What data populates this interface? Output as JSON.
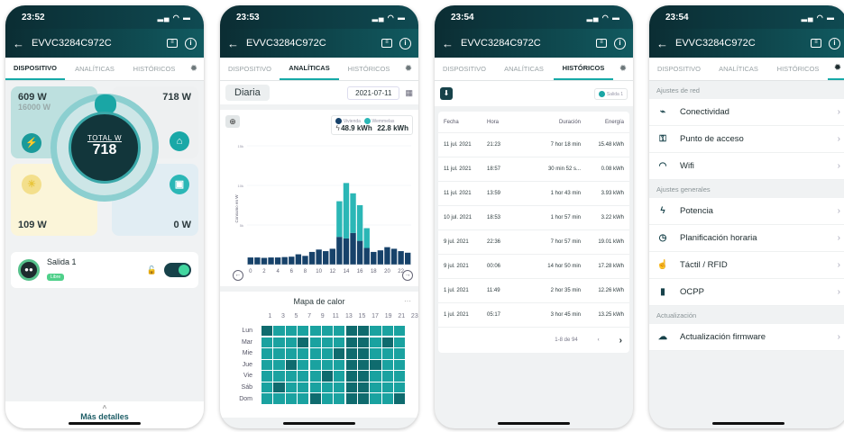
{
  "phones": [
    {
      "time": "23:52",
      "device": "EVVC3284C972C"
    },
    {
      "time": "23:53",
      "device": "EVVC3284C972C"
    },
    {
      "time": "23:54",
      "device": "EVVC3284C972C"
    },
    {
      "time": "23:54",
      "device": "EVVC3284C972C"
    }
  ],
  "tabs": {
    "device": "DISPOSITIVO",
    "analytics": "ANALÍTICAS",
    "history": "HISTÓRICOS"
  },
  "device_screen": {
    "grid_power": "609 W",
    "grid_limit": "16000 W",
    "home_power": "718 W",
    "solar_power": "109 W",
    "car_power": "0 W",
    "total_label": "TOTAL W",
    "total_value": "718",
    "outlet_name": "Salida 1",
    "outlet_status": "Libre",
    "more_details": "Más detalles"
  },
  "analytics_screen": {
    "period": "Diaria",
    "date": "2021-07-11",
    "legend_home_label": "Vivienda",
    "legend_home_value": "48.9 kWh",
    "legend_charger_label": "Wemmelas",
    "legend_charger_value": "22.8 kWh",
    "heatmap_title": "Mapa de calor",
    "heatmap_hours": [
      "1",
      "3",
      "5",
      "7",
      "9",
      "11",
      "13",
      "15",
      "17",
      "19",
      "21",
      "23"
    ],
    "heatmap_days": [
      "Lun",
      "Mar",
      "Mie",
      "Jue",
      "Vie",
      "Sáb",
      "Dom"
    ]
  },
  "chart_data": {
    "type": "bar",
    "title": "",
    "ylabel": "Consumo en W",
    "categories": [
      "0",
      "1",
      "2",
      "3",
      "4",
      "5",
      "6",
      "7",
      "8",
      "9",
      "10",
      "11",
      "12",
      "13",
      "14",
      "15",
      "16",
      "17",
      "18",
      "19",
      "20",
      "21",
      "22",
      "23"
    ],
    "x_tick_labels": [
      "0",
      "2",
      "4",
      "6",
      "8",
      "10",
      "12",
      "14",
      "16",
      "18",
      "20",
      "22"
    ],
    "y_tick_labels": [
      "15k",
      "10k",
      "5k"
    ],
    "ylim": [
      0,
      15000
    ],
    "series": [
      {
        "name": "Vivienda",
        "values": [
          900,
          900,
          850,
          900,
          900,
          950,
          1000,
          1300,
          1100,
          1600,
          1900,
          1700,
          2000,
          3500,
          3300,
          4000,
          3000,
          2100,
          1600,
          1800,
          2200,
          2000,
          1700,
          1500
        ],
        "color": "#17426a"
      },
      {
        "name": "Wemmelas",
        "values": [
          0,
          0,
          0,
          0,
          0,
          0,
          0,
          0,
          0,
          0,
          0,
          0,
          0,
          4500,
          7000,
          5000,
          4500,
          2500,
          0,
          0,
          0,
          0,
          0,
          0
        ],
        "color": "#2bb7b6"
      }
    ]
  },
  "history_screen": {
    "salida_label": "Salida 1",
    "headers": [
      "Fecha",
      "Hora",
      "Duración",
      "Energía"
    ],
    "rows": [
      [
        "11 jul. 2021",
        "21:23",
        "7 hor 18 min",
        "15.48 kWh"
      ],
      [
        "11 jul. 2021",
        "18:57",
        "30 min 52 s...",
        "0.08 kWh"
      ],
      [
        "11 jul. 2021",
        "13:59",
        "1 hor 43 min",
        "3.93 kWh"
      ],
      [
        "10 jul. 2021",
        "18:53",
        "1 hor 57 min",
        "3.22 kWh"
      ],
      [
        "9 jul. 2021",
        "22:36",
        "7 hor 57 min",
        "19.01 kWh"
      ],
      [
        "9 jul. 2021",
        "00:06",
        "14 hor 50 min",
        "17.28 kWh"
      ],
      [
        "1 jul. 2021",
        "11:49",
        "2 hor 35 min",
        "12.26 kWh"
      ],
      [
        "1 jul. 2021",
        "05:17",
        "3 hor 45 min",
        "13.25 kWh"
      ]
    ],
    "pager": "1-8 de 94"
  },
  "settings_screen": {
    "section_network": "Ajustes de red",
    "network_items": [
      "Conectividad",
      "Punto de acceso",
      "Wifi"
    ],
    "section_general": "Ajustes generales",
    "general_items": [
      "Potencia",
      "Planificación horaria",
      "Táctil / RFID",
      "OCPP"
    ],
    "section_update": "Actualización",
    "update_items": [
      "Actualización firmware"
    ]
  }
}
